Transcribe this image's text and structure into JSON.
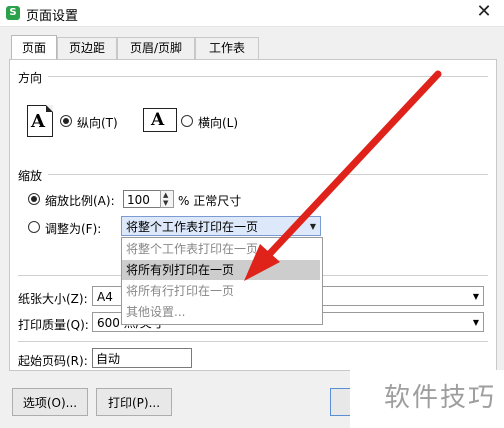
{
  "window": {
    "title": "页面设置",
    "logo_letter": "S"
  },
  "tabs": [
    {
      "label": "页面"
    },
    {
      "label": "页边距"
    },
    {
      "label": "页眉/页脚"
    },
    {
      "label": "工作表"
    }
  ],
  "orientation": {
    "section_label": "方向",
    "portrait_label": "纵向(T)",
    "landscape_label": "横向(L)",
    "paper_letter": "A",
    "selected": "portrait"
  },
  "scaling": {
    "section_label": "缩放",
    "ratio_label": "缩放比例(A):",
    "ratio_value": "100",
    "ratio_suffix": "% 正常尺寸",
    "fit_label": "调整为(F):",
    "fit_selected": "将整个工作表打印在一页",
    "dropdown_options": [
      {
        "label": "将整个工作表打印在一页"
      },
      {
        "label": "将所有列打印在一页"
      },
      {
        "label": "将所有行打印在一页"
      },
      {
        "label": "其他设置..."
      }
    ],
    "highlighted_index": 1
  },
  "paper": {
    "size_label": "纸张大小(Z):",
    "size_value": "A4"
  },
  "quality": {
    "label": "打印质量(Q):",
    "value": "600 点/英寸"
  },
  "first_page": {
    "label": "起始页码(R):",
    "value": "自动"
  },
  "buttons": {
    "options": "选项(O)...",
    "print": "打印(P)..."
  },
  "watermark": {
    "text": "软件技巧"
  },
  "colors": {
    "arrow": "#e0231a",
    "accent": "#2aa14a",
    "selection": "#dde9fb"
  }
}
